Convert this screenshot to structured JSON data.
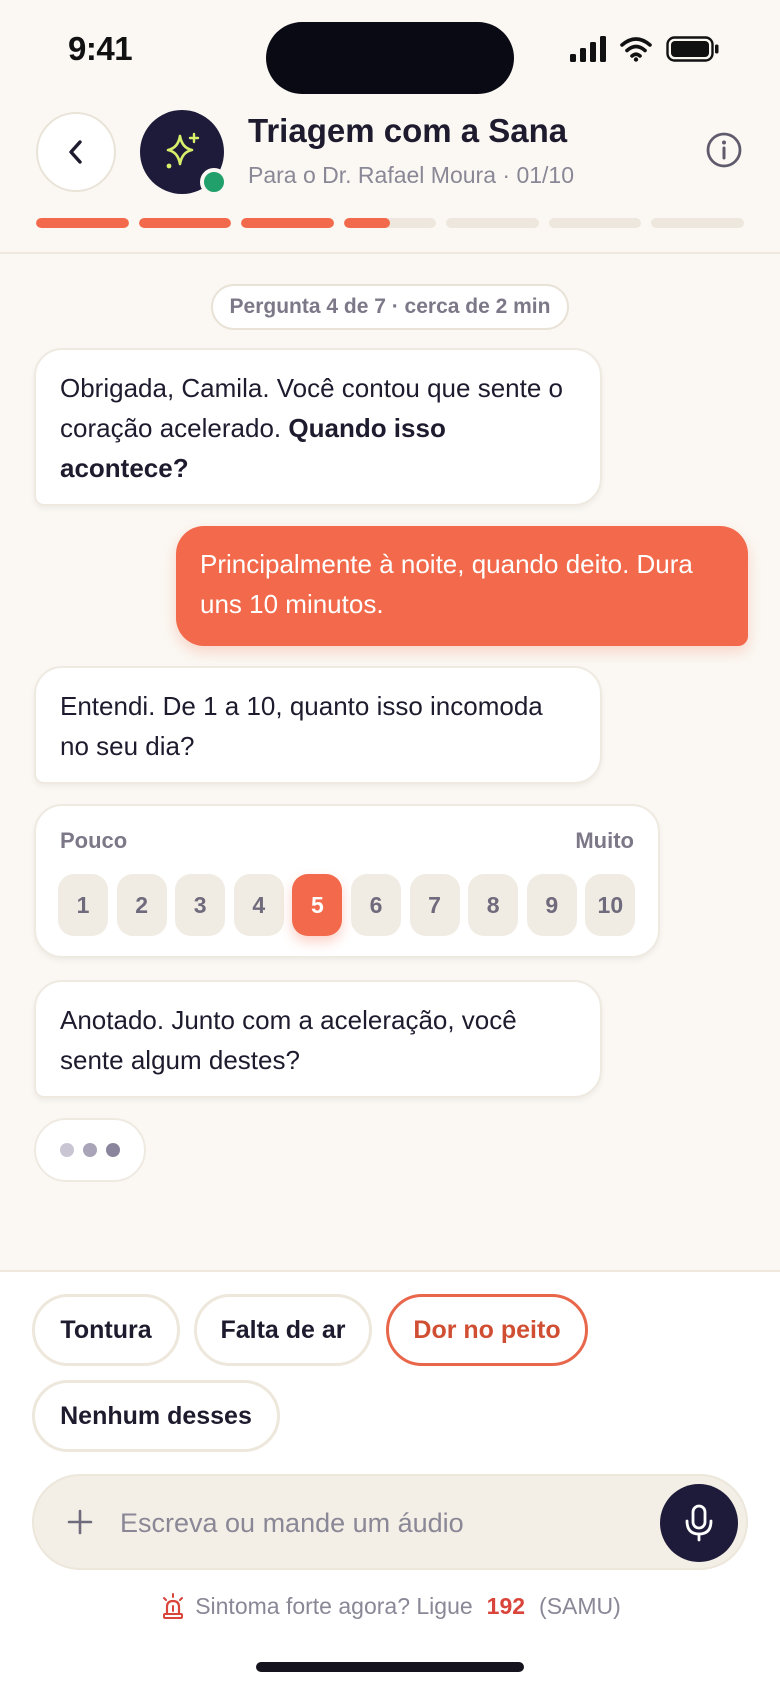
{
  "status_bar": {
    "time": "9:41",
    "icons": [
      "signal-icon",
      "wifi-icon",
      "battery-icon"
    ]
  },
  "header": {
    "title": "Triagem com a Sana",
    "subtitle": "Para o Dr. Rafael Moura · 01/10",
    "avatar_icon": "sparkle-icon",
    "progress": {
      "segments": 7,
      "completed": 3,
      "current_fraction": 0.5
    }
  },
  "chat": {
    "question_pill": "Pergunta 4 de 7 · cerca de 2 min",
    "messages": [
      {
        "from": "bot",
        "text_before": "Obrigada, Camila. Você contou que sente o coração acelerado. ",
        "text_bold": "Quando isso acontece?"
      },
      {
        "from": "user",
        "text": "Principalmente à noite, quando deito. Dura uns 10 minutos."
      },
      {
        "from": "bot",
        "text": "Entendi. De 1 a 10, quanto isso incomoda no seu dia?"
      },
      {
        "from": "bot",
        "text": "Anotado. Junto com a aceleração, você sente algum destes?"
      }
    ],
    "scale": {
      "low_label": "Pouco",
      "high_label": "Muito",
      "options": [
        "1",
        "2",
        "3",
        "4",
        "5",
        "6",
        "7",
        "8",
        "9",
        "10"
      ],
      "selected": "5"
    }
  },
  "quick_replies": [
    "Tontura",
    "Falta de ar",
    "Dor no peito",
    "Nenhum desses"
  ],
  "composer": {
    "placeholder": "Escreva ou mande um áudio"
  },
  "emergency": {
    "text": "Sintoma forte agora? Ligue",
    "number": "192",
    "service": "(SAMU)"
  },
  "colors": {
    "accent": "#F26A4B",
    "dark": "#1E1B3A",
    "online": "#22A06B",
    "alert_text": "#D04F33",
    "emergency_number": "#D9453A"
  }
}
